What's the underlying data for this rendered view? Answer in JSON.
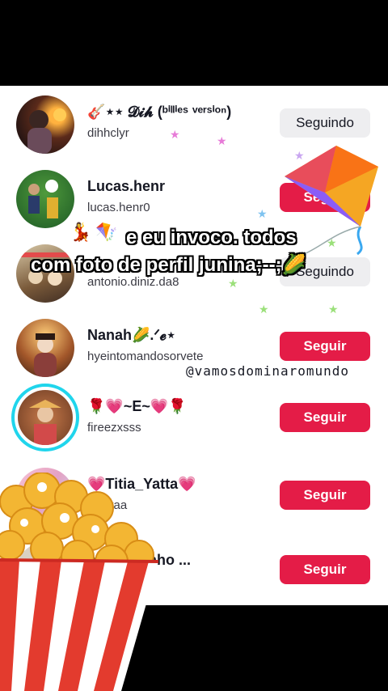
{
  "rows": [
    {
      "name": "🎸⋆⋆ 𝓓𝓲𝓱 (ᵇⁱˡˡⁱᵉˢ ᵛᵉʳˢⁱᵒⁿ)",
      "handle": "dihhclyr",
      "button": "Seguindo",
      "state": "following"
    },
    {
      "name": "Lucas.henr",
      "handle": "lucas.henr0",
      "button": "Seguir",
      "state": "follow"
    },
    {
      "name": "",
      "handle": "antonio.diniz.da8",
      "button": "Seguindo",
      "state": "following"
    },
    {
      "name": "Nanah🌽.ᐟ𝓮⋆",
      "handle": "hyeintomandosorvete",
      "button": "Seguir",
      "state": "follow"
    },
    {
      "name": "🌹💗~E~💗🌹",
      "handle": "fireezxsss",
      "button": "Seguir",
      "state": "follow"
    },
    {
      "name": "💗Titia_Yatta💗",
      "handle": "_yattaa",
      "button": "Seguir",
      "state": "follow"
    },
    {
      "name": "nino n tenho ...",
      "handle": "",
      "button": "Seguir",
      "state": "follow"
    }
  ],
  "overlay": {
    "line1": "e eu invoco. todos",
    "line2": "com foto de perfil junina;--;🌽",
    "watermark": "@vamosdominaromundo"
  },
  "colors": {
    "follow_red": "#e41c47",
    "story_ring": "#20d5ec",
    "following_bg": "#eeeef0"
  }
}
